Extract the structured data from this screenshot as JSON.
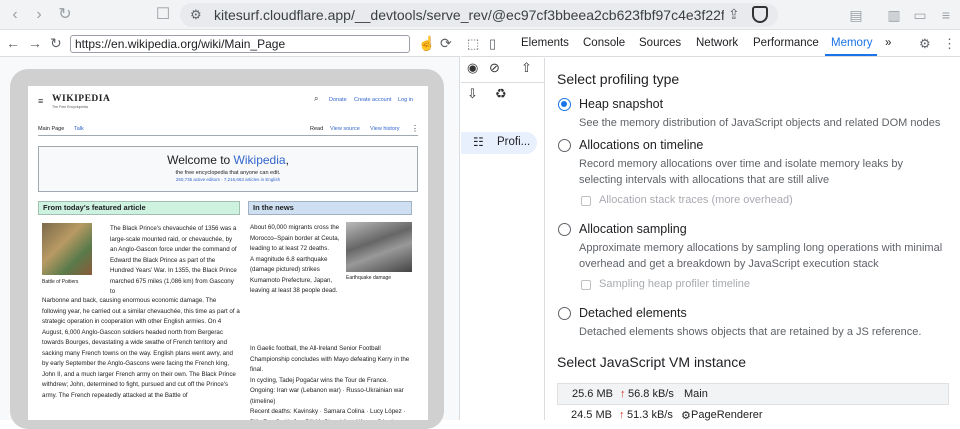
{
  "browser": {
    "address": "kitesurf.cloudflare.app/__devtools/serve_rev/@ec97cf3bbeea2cb623fbf97c4e3f22f5ac..."
  },
  "emulator": {
    "url": "https://en.wikipedia.org/wiki/Main_Page"
  },
  "wiki": {
    "logo": "WIKIPEDIA",
    "tagline": "The Free Encyclopedia",
    "donate": "Donate",
    "create_account": "Create account",
    "login": "Log in",
    "tab_main": "Main Page",
    "tab_talk": "Talk",
    "tab_read": "Read",
    "tab_view_source": "View source",
    "tab_view_history": "View history",
    "welcome_prefix": "Welcome to ",
    "welcome_link": "Wikipedia",
    "welcome_suffix": ",",
    "welcome_sub": "the free encyclopedia that anyone can edit.",
    "welcome_stats": "250,735 active editors · 7,216,663 articles in English",
    "featured_heading": "From today's featured article",
    "news_heading": "In the news",
    "featured_caption": "Battle of Poitiers",
    "featured_text_a": "The Black Prince's chevauchée of 1356 was a large-scale mounted raid, or chevauchée, by an Anglo-Gascon force under the command of Edward the Black Prince as part of the Hundred Years' War. In 1355, the Black Prince marched 675 miles (1,086 km) from Gascony to",
    "featured_text_b": "Narbonne and back, causing enormous economic damage. The following year, he carried out a similar chevauchée, this time as part of a strategic operation in cooperation with other English armies. On 4 August, 6,000 Anglo-Gascon soldiers headed north from Bergerac towards Bourges, devastating a wide swathe of French territory and sacking many French towns on the way. English plans went awry, and by early September the Anglo-Gascons were facing the French king, John II, and a much larger French army on their own. The Black Prince withdrew; John, determined to fight, pursued and cut off the Prince's army. The French repeatedly attacked at the Battle of",
    "news_items": [
      "About 60,000 migrants cross the Morocco–Spain border at Ceuta, leading to at least 72 deaths.",
      "A magnitude 6.8 earthquake (damage pictured) strikes Kumamoto Prefecture, Japan, leaving at least 38 people dead.",
      "In Gaelic football, the All-Ireland Senior Football Championship concludes with Mayo defeating Kerry in the final.",
      "In cycling, Tadej Pogačar wins the Tour de France."
    ],
    "news_caption": "Earthquake damage",
    "ongoing": "Ongoing: Iran war (Lebanon war) · Russo-Ukrainian war (timeline)",
    "recent_deaths": "Recent deaths: Kavinsky · Samara Colina · Lucy López · Billy Ray Smith Jr. · Bill McGlaughlin · Alfonso Sánchez Anaya"
  },
  "devtools": {
    "tabs": [
      "Elements",
      "Console",
      "Sources",
      "Network",
      "Performance",
      "Memory"
    ],
    "active_tab": "Memory",
    "more_tabs": "»",
    "sidebar_item": "Profi...",
    "heading": "Select profiling type",
    "options": [
      {
        "label": "Heap snapshot",
        "desc": "See the memory distribution of JavaScript objects and related DOM nodes",
        "checked": true
      },
      {
        "label": "Allocations on timeline",
        "desc": "Record memory allocations over time and isolate memory leaks by selecting intervals with allocations that are still alive",
        "checked": false
      },
      {
        "label": "Allocation sampling",
        "desc": "Approximate memory allocations by sampling long operations with minimal overhead and get a breakdown by JavaScript execution stack",
        "checked": false
      },
      {
        "label": "Detached elements",
        "desc": "Detached elements shows objects that are retained by a JS reference.",
        "checked": false
      }
    ],
    "checkbox_stack_traces": "Allocation stack traces (more overhead)",
    "checkbox_heap_timeline": "Sampling heap profiler timeline",
    "vm_heading": "Select JavaScript VM instance",
    "vm_rows": [
      {
        "size": "25.6 MB",
        "rate": "56.8 kB/s",
        "name": "Main"
      },
      {
        "size": "24.5 MB",
        "rate": "51.3 kB/s",
        "name": "PageRenderer"
      }
    ]
  },
  "colors": {
    "accent": "#1a73e8",
    "rate_up": "#d93025",
    "featured_bg": "#cef2e0",
    "news_bg": "#cedff2"
  }
}
